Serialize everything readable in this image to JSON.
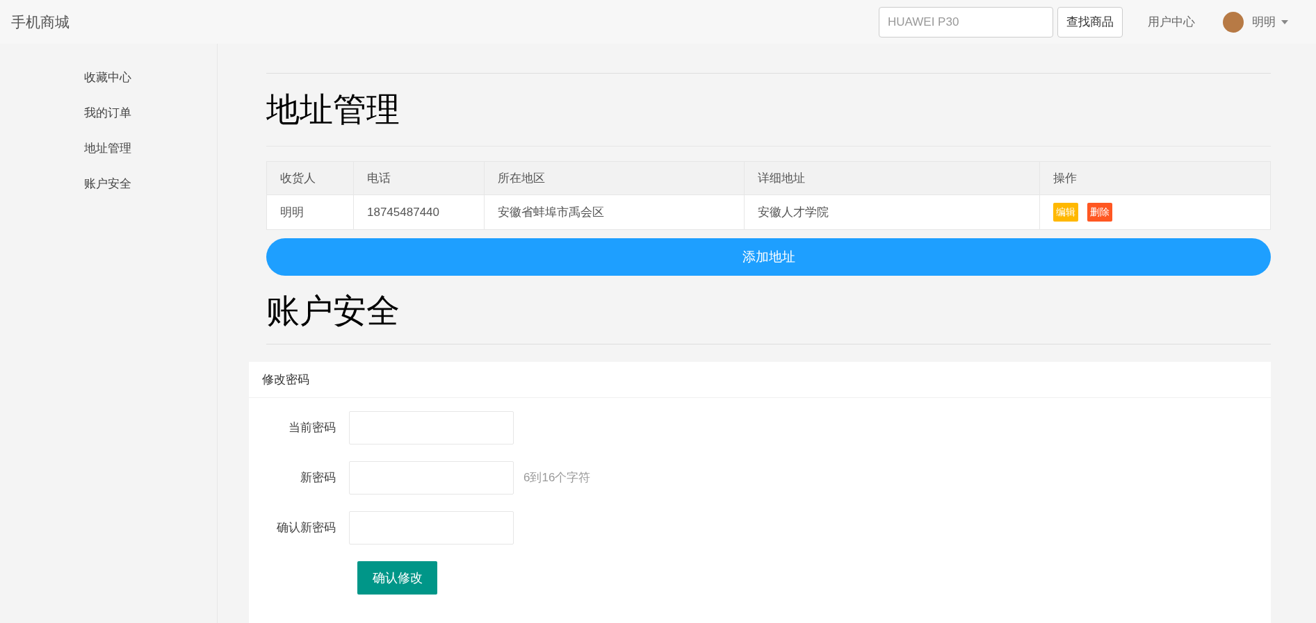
{
  "header": {
    "logo": "手机商城",
    "search": {
      "placeholder": "HUAWEI P30"
    },
    "search_button": "查找商品",
    "user_center": "用户中心",
    "user_name": "明明"
  },
  "sidebar": {
    "items": [
      "收藏中心",
      "我的订单",
      "地址管理",
      "账户安全"
    ]
  },
  "address": {
    "title": "地址管理",
    "table": {
      "columns": [
        "收货人",
        "电话",
        "所在地区",
        "详细地址",
        "操作"
      ],
      "rows": [
        {
          "cells": [
            "明明",
            "18745487440",
            "安徽省蚌埠市禹会区",
            "安徽人才学院"
          ],
          "actions": [
            {
              "label": "编辑",
              "color": "#ffb800"
            },
            {
              "label": "删除",
              "color": "#ff5722"
            }
          ]
        }
      ]
    },
    "add_button": "添加地址"
  },
  "security": {
    "title": "账户安全",
    "card_title": "修改密码",
    "fields": [
      {
        "label": "当前密码"
      },
      {
        "label": "新密码",
        "hint": "6到16个字符"
      },
      {
        "label": "确认新密码"
      }
    ],
    "submit": "确认修改"
  }
}
